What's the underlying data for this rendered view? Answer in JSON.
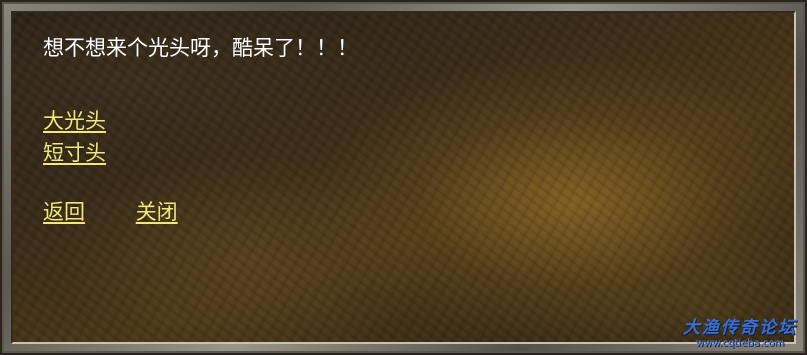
{
  "dialog": {
    "message": "想不想来个光头呀，酷呆了！！！",
    "options": [
      {
        "label": "大光头"
      },
      {
        "label": "短寸头"
      }
    ],
    "actions": {
      "back_label": "返回",
      "close_label": "关闭"
    }
  },
  "watermark": {
    "title": "大渔传奇论坛",
    "url": "www.cqtieba.com"
  },
  "colors": {
    "message_text": "#ffffff",
    "link_text": "#f0e878",
    "watermark": "#3a6fd0"
  }
}
